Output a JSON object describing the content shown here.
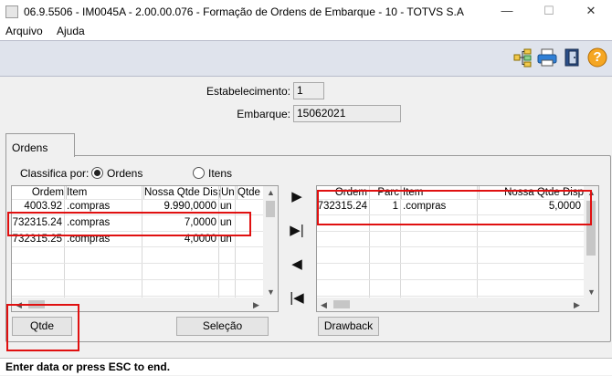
{
  "window": {
    "title": "06.9.5506 - IM0045A - 2.00.00.076 - Formação de Ordens de Embarque - 10 - TOTVS S.A",
    "minimize_glyph": "—",
    "maximize_glyph": "☐",
    "close_glyph": "✕"
  },
  "menu": [
    "Arquivo",
    "Ajuda"
  ],
  "toolbar": {
    "icons": [
      "tree-icon",
      "printer-icon",
      "exit-door-icon",
      "help-icon"
    ],
    "help_glyph": "?"
  },
  "form": {
    "estabelecimento_label": "Estabelecimento:",
    "estabelecimento_value": "1",
    "embarque_label": "Embarque:",
    "embarque_value": "15062021"
  },
  "tab": {
    "label": "Ordens"
  },
  "classify": {
    "label": "Classifica por:",
    "options": [
      "Ordens",
      "Itens"
    ],
    "selected": "Ordens"
  },
  "left_grid": {
    "columns": [
      "Ordem",
      "Item",
      "Nossa Qtde Disp",
      "Un",
      "Qtde R"
    ],
    "rows": [
      [
        "4003.92",
        ".compras",
        "9.990,0000",
        "un",
        ""
      ],
      [
        "732315.24",
        ".compras",
        "7,0000",
        "un",
        ""
      ],
      [
        "732315.25",
        ".compras",
        "4,0000",
        "un",
        ""
      ]
    ]
  },
  "right_grid": {
    "columns": [
      "Ordem",
      "Parc",
      "Item",
      "Nossa Qtde Disp"
    ],
    "rows": [
      [
        "732315.24",
        "1",
        ".compras",
        "5,0000"
      ]
    ]
  },
  "nav_buttons": {
    "add": "▶",
    "add_all": "▶|",
    "remove": "◀",
    "remove_all": "|◀"
  },
  "buttons": {
    "qtde": "Qtde",
    "selecao": "Seleção",
    "drawback": "Drawback"
  },
  "status": "Enter data or press ESC to end.",
  "colors": {
    "highlight": "#e01010",
    "toolbar_bg": "#dfe3ec"
  }
}
